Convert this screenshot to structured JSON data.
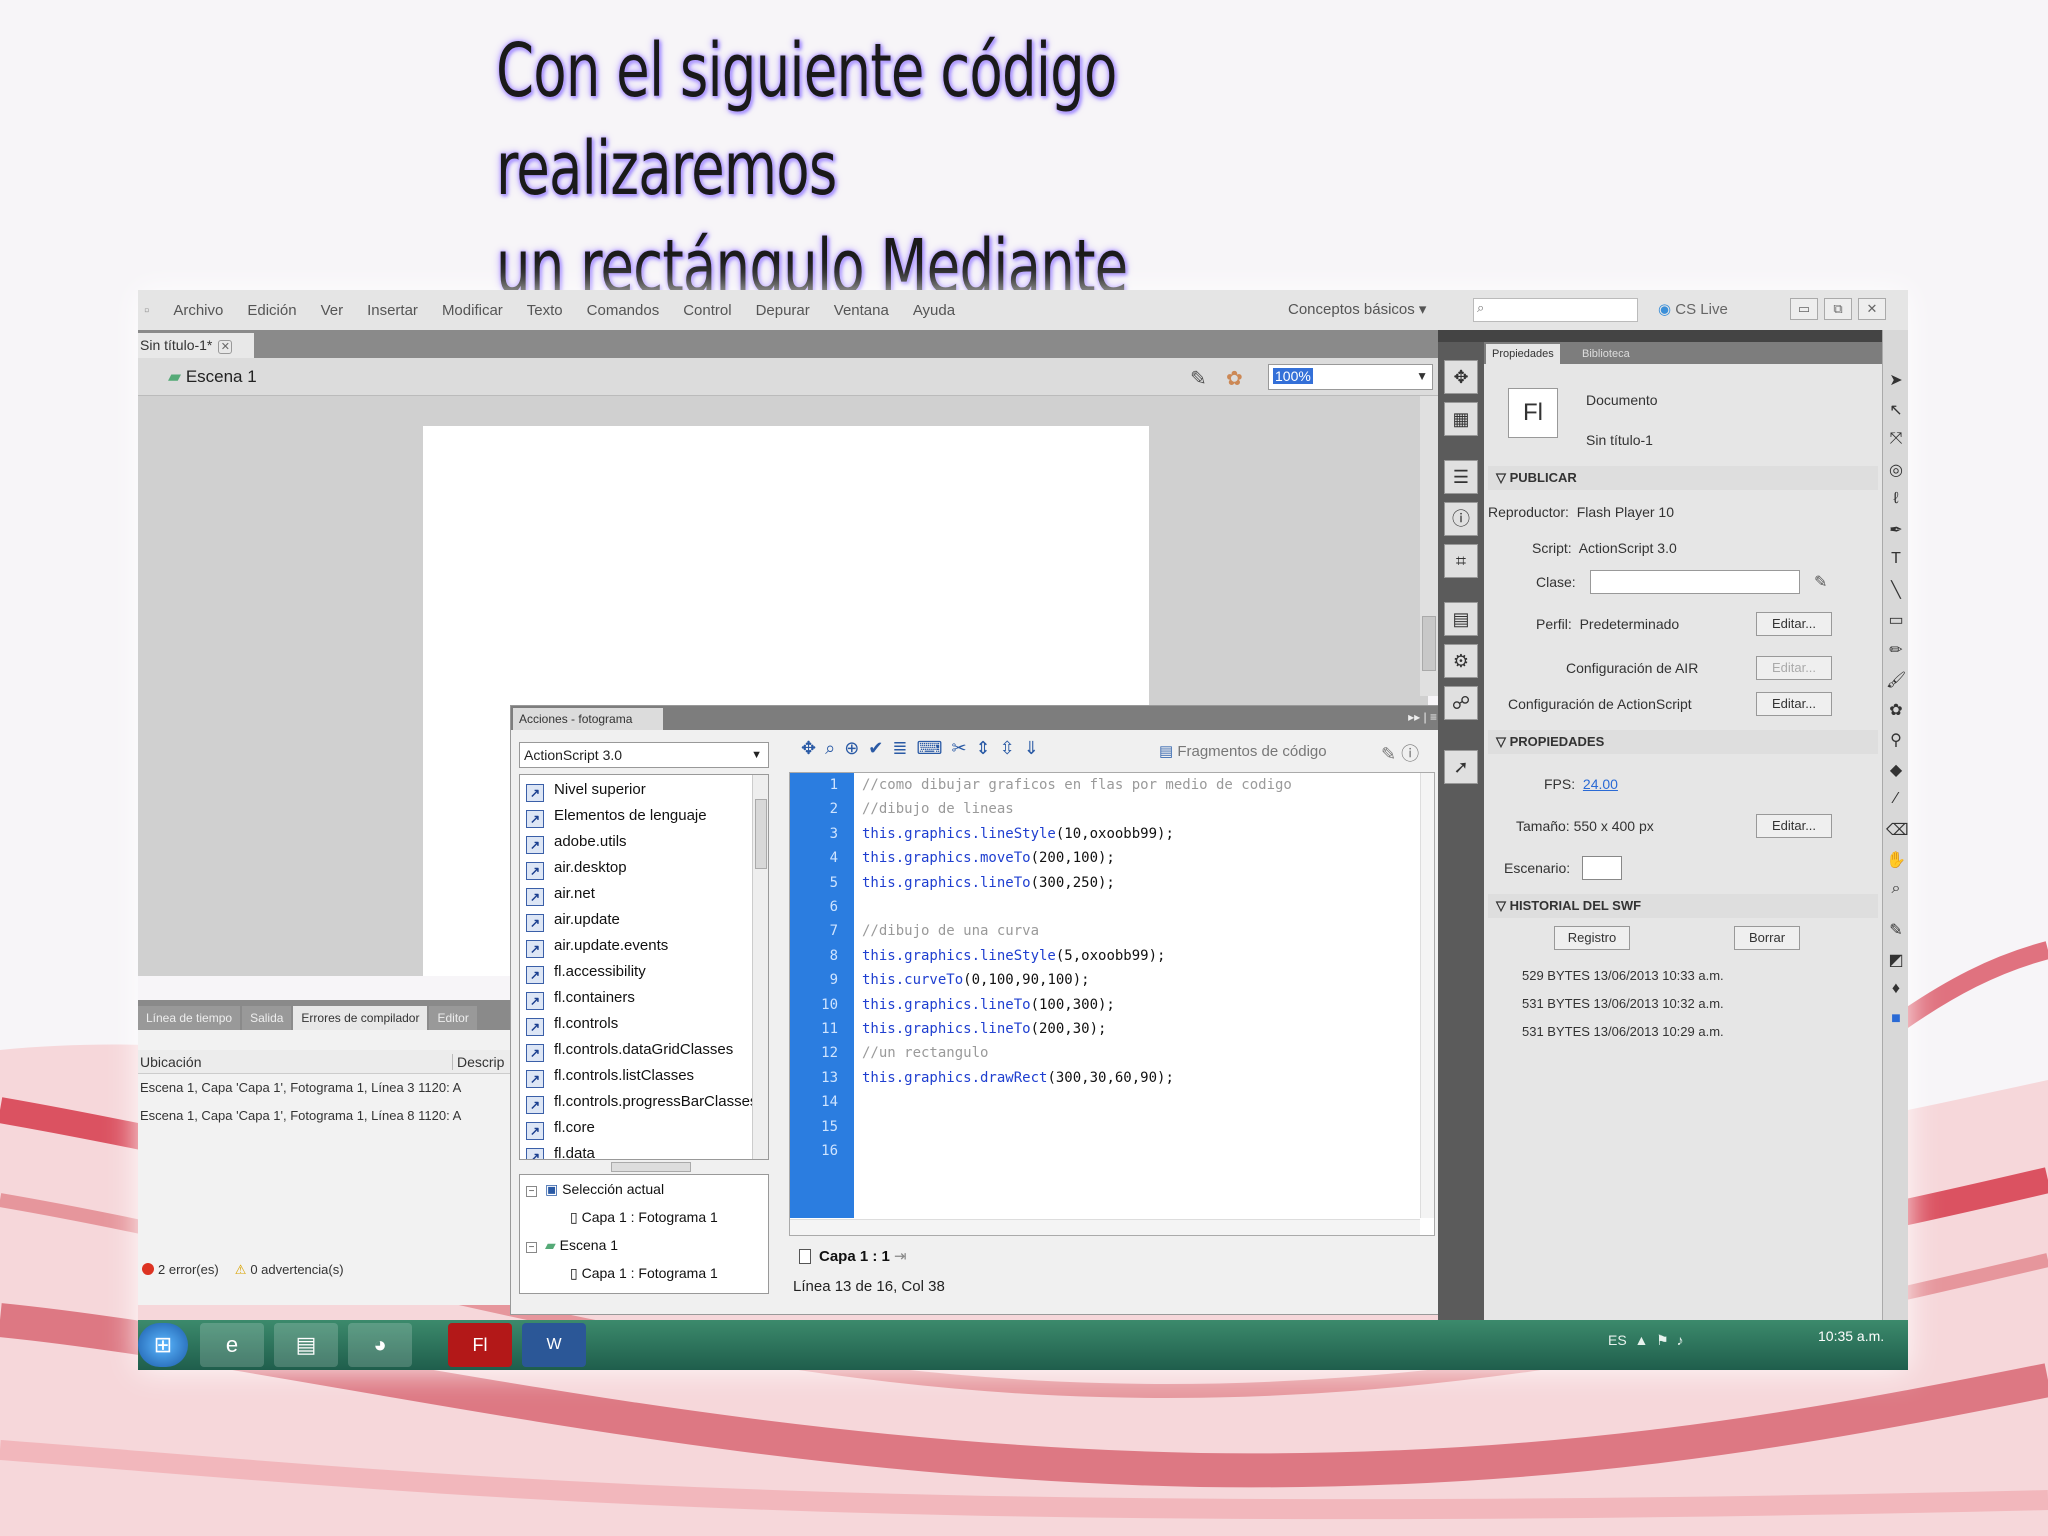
{
  "slide": {
    "title_line1": "Con el siguiente código realizaremos",
    "title_line2": "un rectángulo Mediante drawRect."
  },
  "menubar": {
    "items": [
      "Archivo",
      "Edición",
      "Ver",
      "Insertar",
      "Modificar",
      "Texto",
      "Comandos",
      "Control",
      "Depurar",
      "Ventana",
      "Ayuda"
    ],
    "workspace": "Conceptos básicos",
    "cs_live": "CS Live"
  },
  "document": {
    "tab_label": "Sin título-1*",
    "scene_label": "Escena 1",
    "zoom": "100%"
  },
  "output_panel": {
    "tabs": [
      "Línea de tiempo",
      "Salida",
      "Errores de compilador",
      "Editor"
    ],
    "col_location": "Ubicación",
    "col_description": "Descrip",
    "rows": [
      "Escena 1, Capa 'Capa 1', Fotograma 1, Línea 3   1120: A",
      "Escena 1, Capa 'Capa 1', Fotograma 1, Línea 8   1120: A"
    ],
    "errors": "2 error(es)",
    "warnings": "0 advertencia(s)"
  },
  "actions_panel": {
    "title": "Acciones - fotograma",
    "language": "ActionScript 3.0",
    "packages": [
      "Nivel superior",
      "Elementos de lenguaje",
      "adobe.utils",
      "air.desktop",
      "air.net",
      "air.update",
      "air.update.events",
      "fl.accessibility",
      "fl.containers",
      "fl.controls",
      "fl.controls.dataGridClasses",
      "fl.controls.listClasses",
      "fl.controls.progressBarClasses",
      "fl.core",
      "fl.data"
    ],
    "tree": {
      "selection": "Selección actual",
      "selection_child": "Capa 1 : Fotograma 1",
      "scene": "Escena 1",
      "scene_child": "Capa 1 : Fotograma 1"
    },
    "snippets_label": "Fragmentos de código",
    "code_lines": [
      {
        "n": "1",
        "obj": "",
        "rest": "//como dibujar graficos en flas por medio de codigo",
        "comment": true
      },
      {
        "n": "2",
        "obj": "",
        "rest": "//dibujo de lineas",
        "comment": true
      },
      {
        "n": "3",
        "obj": "this.graphics.lineStyle",
        "rest": "(10,oxoobb99);",
        "comment": false
      },
      {
        "n": "4",
        "obj": "this.graphics.moveTo",
        "rest": "(200,100);",
        "comment": false
      },
      {
        "n": "5",
        "obj": "this.graphics.lineTo",
        "rest": "(300,250);",
        "comment": false
      },
      {
        "n": "6",
        "obj": "",
        "rest": "",
        "comment": false
      },
      {
        "n": "7",
        "obj": "",
        "rest": "//dibujo de una curva",
        "comment": true
      },
      {
        "n": "8",
        "obj": "this.graphics.lineStyle",
        "rest": "(5,oxoobb99);",
        "comment": false
      },
      {
        "n": "9",
        "obj": "this.curveTo",
        "rest": "(0,100,90,100);",
        "comment": false
      },
      {
        "n": "10",
        "obj": "this.graphics.lineTo",
        "rest": "(100,300);",
        "comment": false
      },
      {
        "n": "11",
        "obj": "this.graphics.lineTo",
        "rest": "(200,30);",
        "comment": false
      },
      {
        "n": "12",
        "obj": "",
        "rest": "//un rectangulo",
        "comment": true
      },
      {
        "n": "13",
        "obj": "this.graphics.drawRect",
        "rest": "(300,30,60,90);",
        "comment": false
      },
      {
        "n": "14",
        "obj": "",
        "rest": "",
        "comment": false
      },
      {
        "n": "15",
        "obj": "",
        "rest": "",
        "comment": false
      },
      {
        "n": "16",
        "obj": "",
        "rest": "",
        "comment": false
      }
    ],
    "layer_tab": "Capa 1 : 1",
    "status": "Línea 13 de 16, Col 38"
  },
  "properties": {
    "tab_properties": "Propiedades",
    "tab_library": "Biblioteca",
    "fl_logo": "Fl",
    "doc_label": "Documento",
    "doc_name": "Sin título-1",
    "publish_header": "PUBLICAR",
    "player_label": "Reproductor:",
    "player_value": "Flash Player 10",
    "script_label": "Script:",
    "script_value": "ActionScript 3.0",
    "class_label": "Clase:",
    "profile_label": "Perfil:",
    "profile_value": "Predeterminado",
    "edit": "Editar...",
    "air_config": "Configuración de AIR",
    "as_config": "Configuración de ActionScript",
    "props_header": "PROPIEDADES",
    "fps_label": "FPS:",
    "fps_value": "24.00",
    "size_label": "Tamaño: 550 x 400 px",
    "stage_label": "Escenario:",
    "history_header": "HISTORIAL DEL SWF",
    "log_button": "Registro",
    "clear_button": "Borrar",
    "history": [
      "529 BYTES   13/06/2013   10:33 a.m.",
      "531 BYTES   13/06/2013   10:32 a.m.",
      "531 BYTES   13/06/2013   10:29 a.m."
    ]
  },
  "taskbar": {
    "lang": "ES",
    "clock": "10:35 a.m.",
    "fl_app": "Fl",
    "word_app": "W"
  }
}
